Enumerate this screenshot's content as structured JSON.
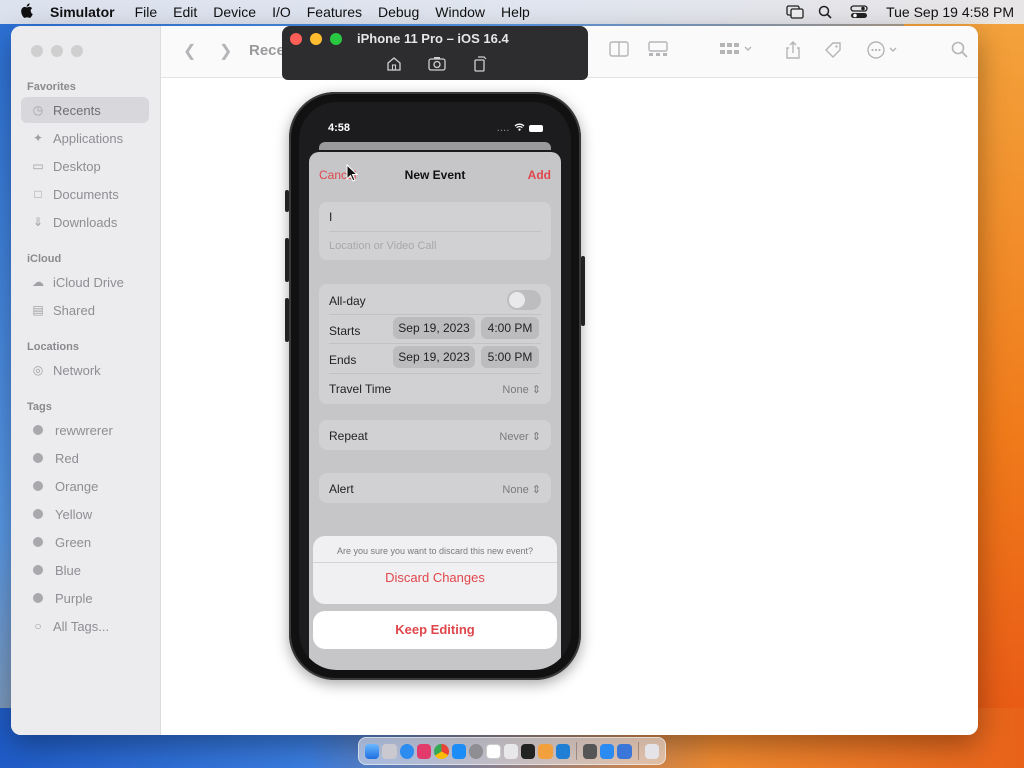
{
  "menubar": {
    "app_name": "Simulator",
    "menus": [
      "File",
      "Edit",
      "Device",
      "I/O",
      "Features",
      "Debug",
      "Window",
      "Help"
    ],
    "clock": "Tue Sep 19  4:58 PM",
    "icons": [
      "screen-mirroring-icon",
      "search-icon",
      "control-center-icon"
    ]
  },
  "finder": {
    "title": "Rece",
    "sidebar": {
      "favorites_label": "Favorites",
      "favorites": [
        {
          "label": "Recents",
          "icon": "clock-icon"
        },
        {
          "label": "Applications",
          "icon": "applications-icon"
        },
        {
          "label": "Desktop",
          "icon": "desktop-icon"
        },
        {
          "label": "Documents",
          "icon": "document-icon"
        },
        {
          "label": "Downloads",
          "icon": "download-icon"
        }
      ],
      "icloud_label": "iCloud",
      "icloud": [
        {
          "label": "iCloud Drive",
          "icon": "cloud-icon"
        },
        {
          "label": "Shared",
          "icon": "shared-folder-icon"
        }
      ],
      "locations_label": "Locations",
      "locations": [
        {
          "label": "Network",
          "icon": "globe-icon"
        }
      ],
      "tags_label": "Tags",
      "tags": [
        "rewwrerer",
        "Red",
        "Orange",
        "Yellow",
        "Green",
        "Blue",
        "Purple",
        "All Tags..."
      ]
    }
  },
  "simulator": {
    "title": "iPhone 11 Pro – iOS 16.4",
    "tools": [
      "home-icon",
      "screenshot-icon",
      "rotate-icon"
    ]
  },
  "phone": {
    "time": "4:58",
    "nav": {
      "cancel": "Cancel",
      "title": "New Event",
      "add": "Add"
    },
    "title_field": "I",
    "location_placeholder": "Location or Video Call",
    "all_day_label": "All-day",
    "starts_label": "Starts",
    "starts_date": "Sep 19, 2023",
    "starts_time": "4:00 PM",
    "ends_label": "Ends",
    "ends_date": "Sep 19, 2023",
    "ends_time": "5:00 PM",
    "travel_time_label": "Travel Time",
    "travel_time_value": "None",
    "repeat_label": "Repeat",
    "repeat_value": "Never",
    "alert_label": "Alert",
    "alert_value": "None",
    "action_sheet": {
      "message": "Are you sure you want to discard this new event?",
      "discard": "Discard Changes",
      "keep": "Keep Editing"
    }
  },
  "colors": {
    "ios_red": "#e0474c",
    "finder_sidebar": "#ececee",
    "sim_header": "#2d2d30"
  }
}
